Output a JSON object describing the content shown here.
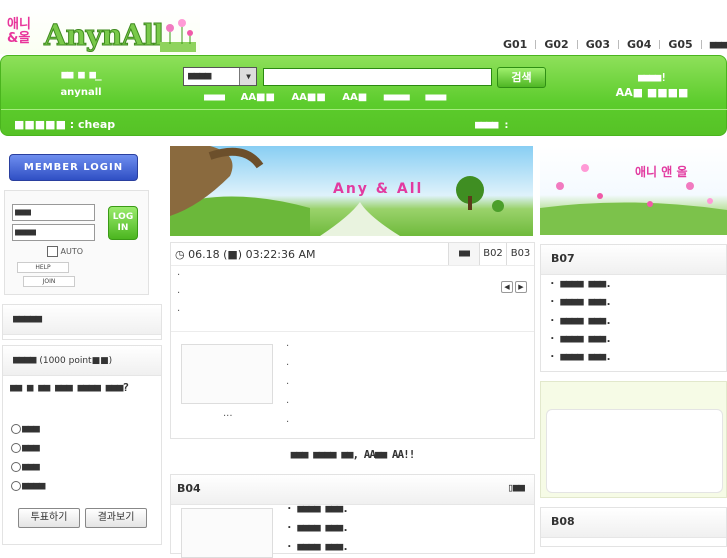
{
  "logo": {
    "korean": "애니&올",
    "word": "AnynAll"
  },
  "topnav": {
    "items": [
      "G01",
      "G02",
      "G03",
      "G04",
      "G05",
      "■■■■"
    ]
  },
  "bar": {
    "nick_line1": "■■ ■ ■_",
    "nick_line2": "anynall",
    "select_value": "■■■■",
    "search_placeholder": "",
    "search_button": "검색",
    "hot_keywords": [
      "■■■■",
      "AA■■",
      "AA■■",
      "AA■",
      "■■■■■",
      "■■■■"
    ],
    "right_line1": "■■■■!",
    "right_line2": "AA■ ■■■■",
    "cheap_text": "■■■■■ : cheap",
    "right_bottom": "■■■■ :"
  },
  "login": {
    "member_login": "MEMBER LOGIN",
    "id_placeholder": "■■■",
    "pw_placeholder": "■■■■",
    "login_button": "LOG IN",
    "auto_label": "AUTO",
    "help": "HELP",
    "join": "JOIN"
  },
  "left_panel1": {
    "title": "■■■■■"
  },
  "poll": {
    "title": "■■■■",
    "title_note": "(1000 point■■)",
    "question": "■■ ■ ■■ ■■■ ■■■■ ■■■?",
    "options": [
      "■■■",
      "■■■",
      "■■■",
      "■■■■"
    ],
    "vote_button": "투표하기",
    "result_button": "결과보기"
  },
  "banner": {
    "text": "Any  &  All"
  },
  "news": {
    "date": "06.18 (■) 03:22:36 AM",
    "tabs": [
      "■■",
      "B02",
      "B03"
    ],
    "ellipsis": "..."
  },
  "welcome": {
    "text": "■■■ ■■■■ ■■, AA■■ AA!!"
  },
  "b04": {
    "title": "B04",
    "items": [
      "■■■■ ■■■",
      "■■■■ ■■■",
      "■■■■ ■■■"
    ],
    "more": "■■"
  },
  "rbanner": {
    "text": "애니 앤 올"
  },
  "b07": {
    "title": "B07",
    "items": [
      "■■■■ ■■■",
      "■■■■ ■■■",
      "■■■■ ■■■",
      "■■■■ ■■■",
      "■■■■ ■■■"
    ]
  },
  "b08": {
    "title": "B08"
  },
  "colors": {
    "green": "#5ccc2c",
    "login_blue": "#2f4fc4",
    "pink": "#e23aa0"
  }
}
